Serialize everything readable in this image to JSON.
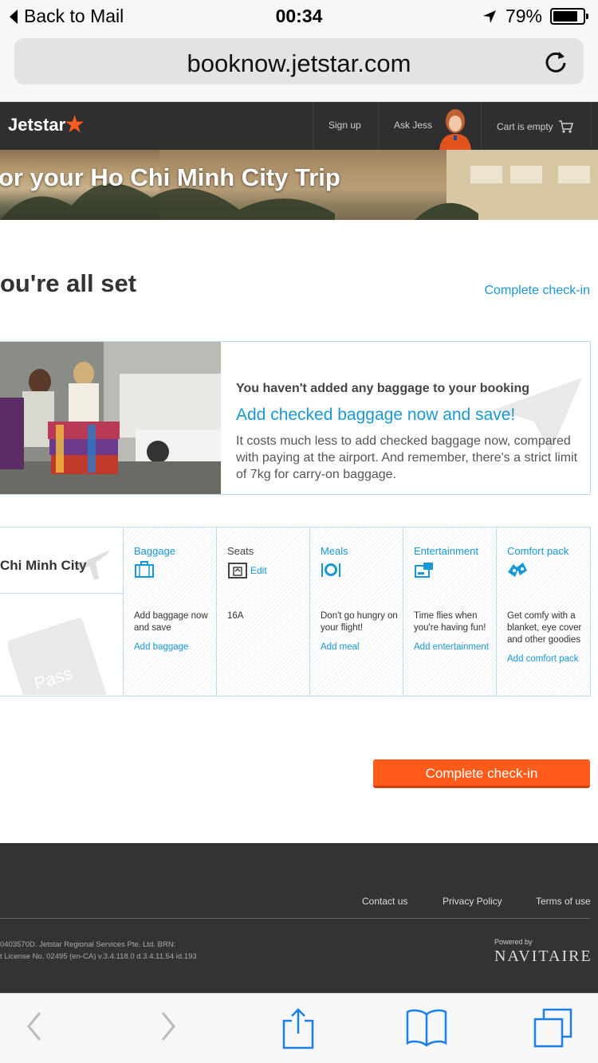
{
  "status_bar": {
    "back_label": "Back to Mail",
    "time": "00:34",
    "battery": "79%"
  },
  "browser": {
    "url": "booknow.jetstar.com"
  },
  "header": {
    "logo": "Jetstar",
    "sign_up": "Sign up",
    "ask_jess": "Ask Jess",
    "cart": "Cart is empty"
  },
  "banner": {
    "title": "or your Ho Chi Minh City Trip"
  },
  "main": {
    "heading": "ou're all set",
    "complete_checkin_link": "Complete check-in"
  },
  "baggage_promo": {
    "headline": "You haven't added any baggage to your booking",
    "cta": "Add checked baggage now and save!",
    "description": "It costs much less to add checked baggage now, compared with paying at the airport. And remember, there's a strict limit of 7kg for carry-on baggage."
  },
  "services": {
    "city": "Chi Minh City",
    "columns": [
      {
        "title": "Baggage",
        "icon": "suitcase-icon",
        "body": "Add baggage now and save",
        "link": "Add baggage"
      },
      {
        "title": "Seats",
        "icon": "seat-icon",
        "edit": "Edit",
        "body": "16A",
        "link": ""
      },
      {
        "title": "Meals",
        "icon": "meal-icon",
        "body": "Don't go hungry on your flight!",
        "link": "Add meal"
      },
      {
        "title": "Entertainment",
        "icon": "entertainment-icon",
        "body": "Time flies when you're having fun!",
        "link": "Add entertainment"
      },
      {
        "title": "Comfort pack",
        "icon": "comfort-pack-icon",
        "body": "Get comfy with a blanket, eye cover and other goodies",
        "link": "Add comfort pack"
      }
    ]
  },
  "cta_button": {
    "label": "Complete check-in"
  },
  "footer": {
    "contact": "Contact us",
    "privacy": "Privacy Policy",
    "terms": "Terms of use",
    "legal_line1": "0403570D. Jetstar Regional Services Pte. Ltd. BRN:",
    "legal_line2": "t License No. 02495 (en-CA) v.3.4.118.0 d.3.4.11.54  id.193",
    "powered_by": "Powered by",
    "navitaire": "NAVITAIRE"
  },
  "colors": {
    "accent_blue": "#1a98d5",
    "cta_orange": "#ff5b1a",
    "header_dark": "#2f2f2f"
  }
}
